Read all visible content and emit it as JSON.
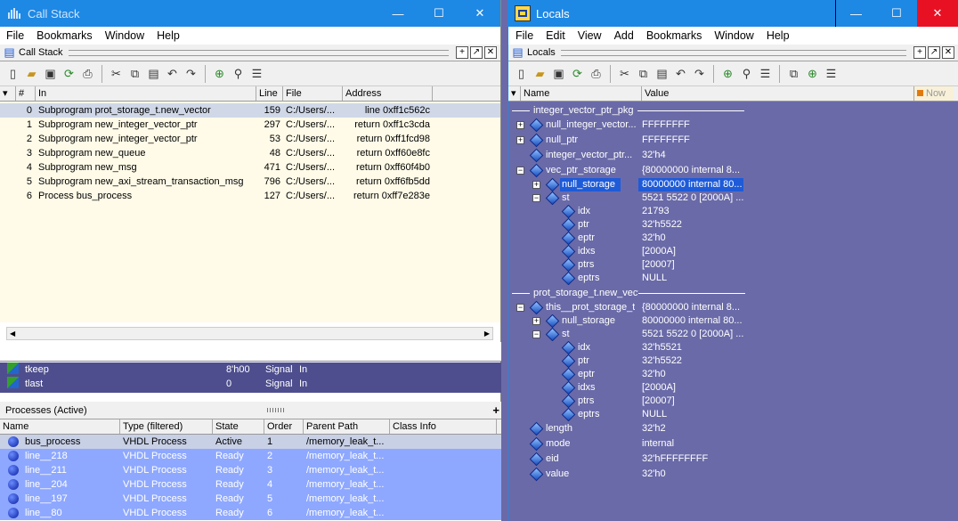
{
  "callstack_window": {
    "title": "Call Stack",
    "menu": [
      "File",
      "Bookmarks",
      "Window",
      "Help"
    ],
    "panel_title": "Call Stack",
    "columns": [
      "#",
      "In",
      "Line",
      "File",
      "Address"
    ],
    "rows": [
      {
        "num": "0",
        "in": "Subprogram prot_storage_t.new_vector",
        "line": "159",
        "file": "C:/Users/...",
        "address": "line 0xff1c562c"
      },
      {
        "num": "1",
        "in": "Subprogram new_integer_vector_ptr",
        "line": "297",
        "file": "C:/Users/...",
        "address": "return 0xff1c3cda"
      },
      {
        "num": "2",
        "in": "Subprogram new_integer_vector_ptr",
        "line": "53",
        "file": "C:/Users/...",
        "address": "return 0xff1fcd98"
      },
      {
        "num": "3",
        "in": "Subprogram new_queue",
        "line": "48",
        "file": "C:/Users/...",
        "address": "return 0xff60e8fc"
      },
      {
        "num": "4",
        "in": "Subprogram new_msg",
        "line": "471",
        "file": "C:/Users/...",
        "address": "return 0xff60f4b0"
      },
      {
        "num": "5",
        "in": "Subprogram new_axi_stream_transaction_msg",
        "line": "796",
        "file": "C:/Users/...",
        "address": "return 0xff6fb5dd"
      },
      {
        "num": "6",
        "in": "Process bus_process",
        "line": "127",
        "file": "C:/Users/...",
        "address": "return 0xff7e283e"
      }
    ]
  },
  "signals": [
    {
      "name": "tkeep",
      "value": "8'h00",
      "kind": "Signal",
      "mode": "In"
    },
    {
      "name": "tlast",
      "value": "0",
      "kind": "Signal",
      "mode": "In"
    }
  ],
  "processes": {
    "title": "Processes (Active)",
    "columns": [
      "Name",
      "Type (filtered)",
      "State",
      "Order",
      "Parent Path",
      "Class Info"
    ],
    "rows": [
      {
        "name": "bus_process",
        "type": "VHDL Process",
        "state": "Active",
        "order": "1",
        "path": "/memory_leak_t..."
      },
      {
        "name": "line__218",
        "type": "VHDL Process",
        "state": "Ready",
        "order": "2",
        "path": "/memory_leak_t..."
      },
      {
        "name": "line__211",
        "type": "VHDL Process",
        "state": "Ready",
        "order": "3",
        "path": "/memory_leak_t..."
      },
      {
        "name": "line__204",
        "type": "VHDL Process",
        "state": "Ready",
        "order": "4",
        "path": "/memory_leak_t..."
      },
      {
        "name": "line__197",
        "type": "VHDL Process",
        "state": "Ready",
        "order": "5",
        "path": "/memory_leak_t..."
      },
      {
        "name": "line__80",
        "type": "VHDL Process",
        "state": "Ready",
        "order": "6",
        "path": "/memory_leak_t..."
      }
    ]
  },
  "locals_window": {
    "title": "Locals",
    "menu": [
      "File",
      "Edit",
      "View",
      "Add",
      "Bookmarks",
      "Window",
      "Help"
    ],
    "panel_title": "Locals",
    "columns": [
      "Name",
      "Value"
    ],
    "now_label": "Now",
    "section1": "integer_vector_ptr_pkg",
    "section2": "prot_storage_t.new_vect",
    "items1": [
      {
        "name": "null_integer_vector...",
        "value": "FFFFFFFF",
        "indent": 0,
        "exp": "+"
      },
      {
        "name": "null_ptr",
        "value": "FFFFFFFF",
        "indent": 0,
        "exp": "+"
      },
      {
        "name": "integer_vector_ptr...",
        "value": "32'h4",
        "indent": 0,
        "exp": ""
      },
      {
        "name": "vec_ptr_storage",
        "value": "{80000000 internal 8...",
        "indent": 0,
        "exp": "-"
      },
      {
        "name": "null_storage",
        "value": "80000000 internal 80...",
        "indent": 1,
        "exp": "+",
        "selected": true
      },
      {
        "name": "st",
        "value": "5521 5522 0 [2000A] ...",
        "indent": 1,
        "exp": "-"
      },
      {
        "name": "idx",
        "value": "21793",
        "indent": 2,
        "exp": ""
      },
      {
        "name": "ptr",
        "value": "32'h5522",
        "indent": 2,
        "exp": ""
      },
      {
        "name": "eptr",
        "value": "32'h0",
        "indent": 2,
        "exp": ""
      },
      {
        "name": "idxs",
        "value": "[2000A]",
        "indent": 2,
        "exp": ""
      },
      {
        "name": "ptrs",
        "value": "[20007]",
        "indent": 2,
        "exp": ""
      },
      {
        "name": "eptrs",
        "value": "NULL",
        "indent": 2,
        "exp": ""
      }
    ],
    "items2": [
      {
        "name": "this__prot_storage_t",
        "value": "{80000000 internal 8...",
        "indent": 0,
        "exp": "-"
      },
      {
        "name": "null_storage",
        "value": "80000000 internal 80...",
        "indent": 1,
        "exp": "+"
      },
      {
        "name": "st",
        "value": "5521 5522 0 [2000A] ...",
        "indent": 1,
        "exp": "-"
      },
      {
        "name": "idx",
        "value": "32'h5521",
        "indent": 2,
        "exp": ""
      },
      {
        "name": "ptr",
        "value": "32'h5522",
        "indent": 2,
        "exp": ""
      },
      {
        "name": "eptr",
        "value": "32'h0",
        "indent": 2,
        "exp": ""
      },
      {
        "name": "idxs",
        "value": "[2000A]",
        "indent": 2,
        "exp": ""
      },
      {
        "name": "ptrs",
        "value": "[20007]",
        "indent": 2,
        "exp": ""
      },
      {
        "name": "eptrs",
        "value": "NULL",
        "indent": 2,
        "exp": ""
      },
      {
        "name": "length",
        "value": "32'h2",
        "indent": 0,
        "exp": ""
      },
      {
        "name": "mode",
        "value": "internal",
        "indent": 0,
        "exp": ""
      },
      {
        "name": "eid",
        "value": "32'hFFFFFFFF",
        "indent": 0,
        "exp": ""
      },
      {
        "name": "value",
        "value": "32'h0",
        "indent": 0,
        "exp": ""
      }
    ]
  },
  "window_controls": {
    "minimize": "—",
    "maximize": "☐",
    "close": "✕"
  },
  "colors": {
    "titlebar": "#1e88e5",
    "locals_bg": "#6a6aa8",
    "selected": "#1e5bd8"
  }
}
